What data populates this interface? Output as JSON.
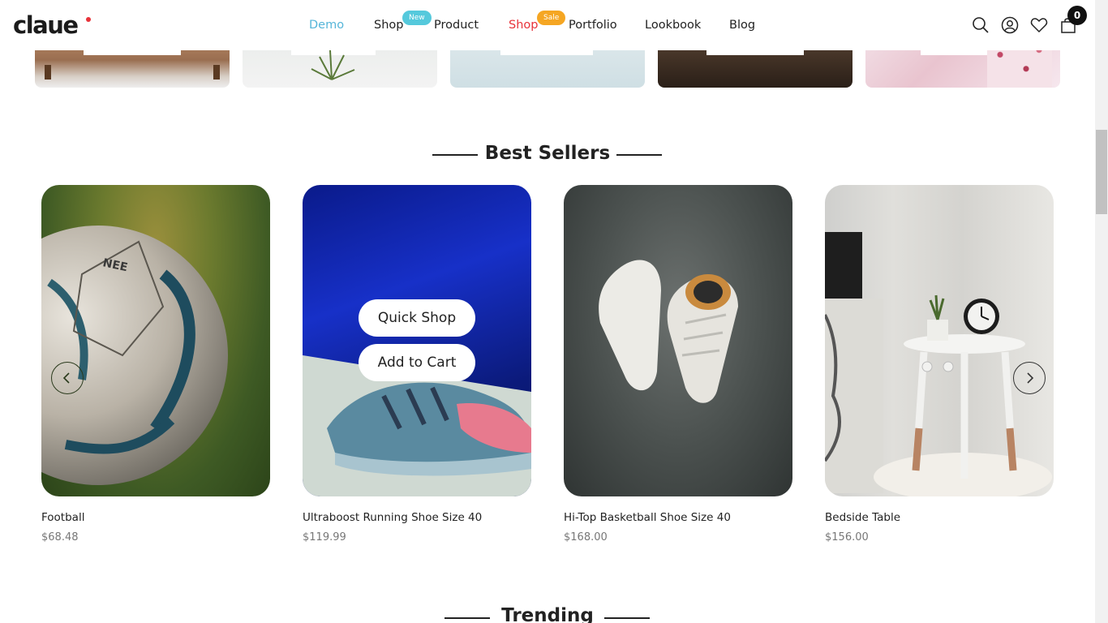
{
  "brand": {
    "logo_text": "claue"
  },
  "nav": {
    "items": [
      {
        "label": "Demo"
      },
      {
        "label": "Shop",
        "badge": "New"
      },
      {
        "label": "Product"
      },
      {
        "label": "Shop",
        "badge": "Sale"
      },
      {
        "label": "Portfolio"
      },
      {
        "label": "Lookbook"
      },
      {
        "label": "Blog"
      }
    ]
  },
  "header_icons": [
    "search-icon",
    "account-icon",
    "wishlist-heart-icon",
    "cart-bag-icon"
  ],
  "cart": {
    "count": "0"
  },
  "best_sellers": {
    "title": "Best Sellers",
    "products": [
      {
        "name": "Football",
        "price": "$68.48"
      },
      {
        "name": "Ultraboost Running Shoe Size 40",
        "price": "$119.99"
      },
      {
        "name": "Hi-Top Basketball Shoe Size 40",
        "price": "$168.00"
      },
      {
        "name": "Bedside Table",
        "price": "$156.00"
      }
    ],
    "hover_actions": {
      "quick_shop": "Quick Shop",
      "add_to_cart": "Add to Cart"
    }
  },
  "trending": {
    "title": "Trending"
  },
  "colors": {
    "accent_blue": "#55b5d9",
    "sale_red": "#e8333a",
    "badge_new": "#55c9dc",
    "badge_sale": "#f5a623"
  }
}
